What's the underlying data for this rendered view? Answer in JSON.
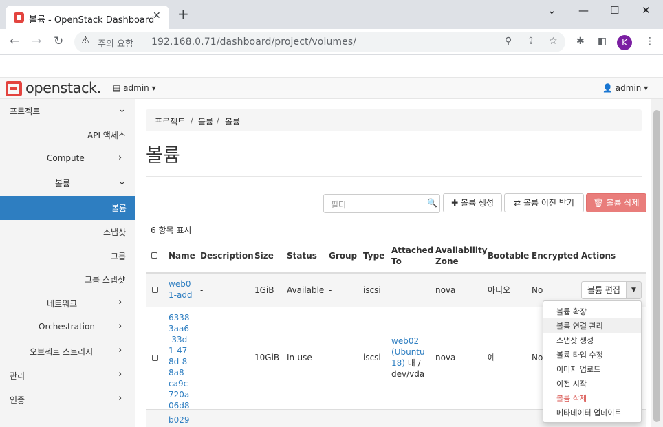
{
  "browser": {
    "tab_title": "볼륨 - OpenStack Dashboard",
    "security_label": "주의 요함",
    "url": "192.168.0.71/dashboard/project/volumes/",
    "profile_initial": "K"
  },
  "header": {
    "logo_text": "openstack.",
    "project_menu": "admin",
    "user_menu": "admin"
  },
  "sidebar": {
    "items": [
      {
        "label": "프로젝트"
      },
      {
        "label": "API 액세스"
      },
      {
        "label": "Compute"
      },
      {
        "label": "볼륨"
      },
      {
        "label": "볼륨"
      },
      {
        "label": "스냅샷"
      },
      {
        "label": "그룹"
      },
      {
        "label": "그룹 스냅샷"
      },
      {
        "label": "네트워크"
      },
      {
        "label": "Orchestration"
      },
      {
        "label": "오브젝트 스토리지"
      },
      {
        "label": "관리"
      },
      {
        "label": "인증"
      }
    ]
  },
  "breadcrumb": [
    "프로젝트",
    "볼륨",
    "볼륨"
  ],
  "page_title": "볼륨",
  "toolbar": {
    "filter_placeholder": "필터",
    "create_label": "볼륨 생성",
    "transfer_label": "볼륨 이전 받기",
    "delete_label": "볼륨 삭제"
  },
  "table": {
    "count_label": "6 항목 표시",
    "headers": [
      "Name",
      "Description",
      "Size",
      "Status",
      "Group",
      "Type",
      "Attached To",
      "Availability Zone",
      "Bootable",
      "Encrypted",
      "Actions"
    ],
    "rows": [
      {
        "name": "web01-add",
        "description": "-",
        "size": "1GiB",
        "status": "Available",
        "group": "-",
        "type": "iscsi",
        "attached_to": "",
        "zone": "nova",
        "bootable": "아니오",
        "encrypted": "No",
        "action": "볼륨 편집"
      },
      {
        "name": "63383aa6-33d1-478d-88a8-ca9c720a06d8",
        "description": "-",
        "size": "10GiB",
        "status": "In-use",
        "group": "-",
        "type": "iscsi",
        "attached_to": "web02(Ubuntu18)",
        "attached_suffix": "내 /dev/vda",
        "zone": "nova",
        "bootable": "예",
        "encrypted": "No"
      },
      {
        "name": "b029"
      }
    ]
  },
  "actions_menu": [
    "볼륨 확장",
    "볼륨 연결 관리",
    "스냅샷 생성",
    "볼륨 타입 수정",
    "이미지 업로드",
    "이전 시작",
    "볼륨 삭제",
    "메타데이터 업데이트"
  ]
}
